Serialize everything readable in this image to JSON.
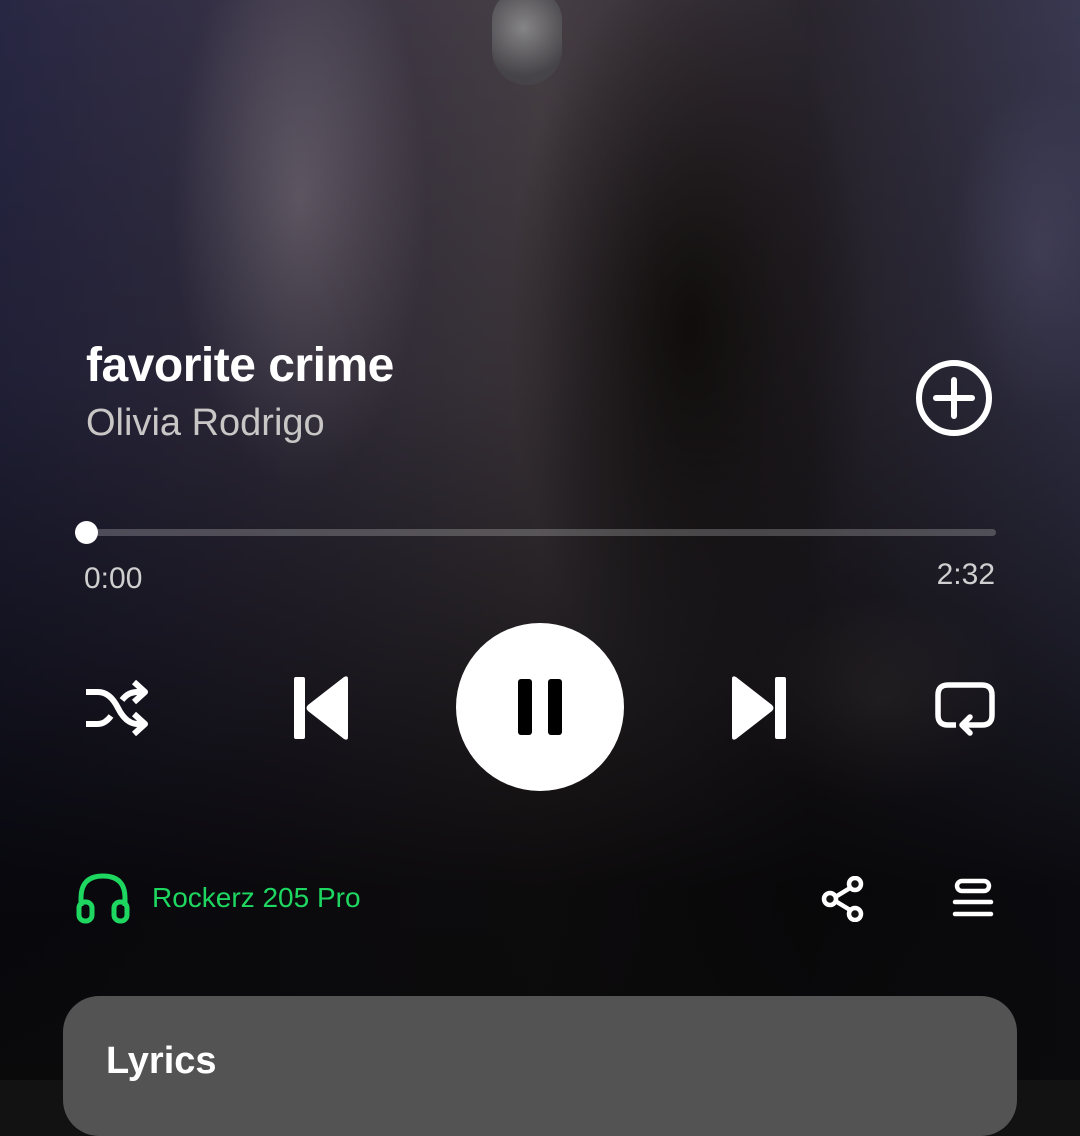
{
  "track": {
    "title": "favorite crime",
    "artist": "Olivia Rodrigo"
  },
  "playback": {
    "elapsed": "0:00",
    "total": "2:32",
    "progress_fraction": 0.0,
    "state": "playing"
  },
  "device": {
    "name": "Rockerz 205 Pro",
    "color": "#1ed760"
  },
  "icons": {
    "add": "plus-circle-icon",
    "shuffle": "shuffle-icon",
    "previous": "skip-previous-icon",
    "pause": "pause-icon",
    "next": "skip-next-icon",
    "repeat": "repeat-icon",
    "device": "headphones-icon",
    "share": "share-icon",
    "queue": "queue-icon"
  },
  "lyrics": {
    "title": "Lyrics"
  }
}
